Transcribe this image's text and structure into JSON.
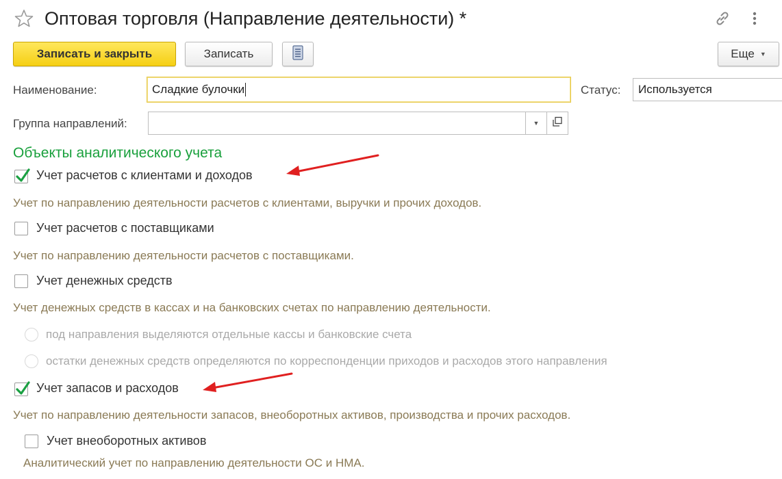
{
  "header": {
    "title": "Оптовая торговля (Направление деятельности) *",
    "icons": [
      "star-icon",
      "link-icon",
      "more-vertical-icon"
    ]
  },
  "toolbar": {
    "save_close_label": "Записать и закрыть",
    "save_label": "Записать",
    "list_icon": "document-list-icon",
    "more_label": "Еще"
  },
  "form": {
    "name_label": "Наименование:",
    "name_value": "Сладкие булочки",
    "status_label": "Статус:",
    "status_value": "Используется",
    "group_label": "Группа направлений:",
    "group_value": ""
  },
  "analytics": {
    "section_title": "Объекты аналитического учета",
    "items": [
      {
        "label": "Учет расчетов с клиентами и доходов",
        "checked": true,
        "hint": "Учет по направлению деятельности расчетов с клиентами, выручки и прочих доходов."
      },
      {
        "label": "Учет расчетов с поставщиками",
        "checked": false,
        "hint": "Учет по направлению деятельности расчетов с поставщиками."
      },
      {
        "label": "Учет денежных средств",
        "checked": false,
        "hint": "Учет денежных средств в кассах и на банковских счетах по направлению деятельности."
      },
      {
        "label": "Учет запасов и расходов",
        "checked": true,
        "hint": "Учет по направлению деятельности запасов, внеоборотных активов, производства и прочих расходов."
      },
      {
        "label": "Учет внеоборотных активов",
        "checked": false,
        "hint": "Аналитический учет по направлению деятельности ОС и НМА."
      }
    ],
    "cash_options": [
      "под направления выделяются отдельные кассы и банковские счета",
      "остатки денежных средств определяются по корреспонденции приходов и расходов этого направления"
    ]
  },
  "colors": {
    "accent_yellow": "#f5cf14",
    "section_green": "#19a03c",
    "check_green": "#1aa042",
    "hint_brown": "#8a7a55",
    "annotation_red": "#e02020"
  }
}
